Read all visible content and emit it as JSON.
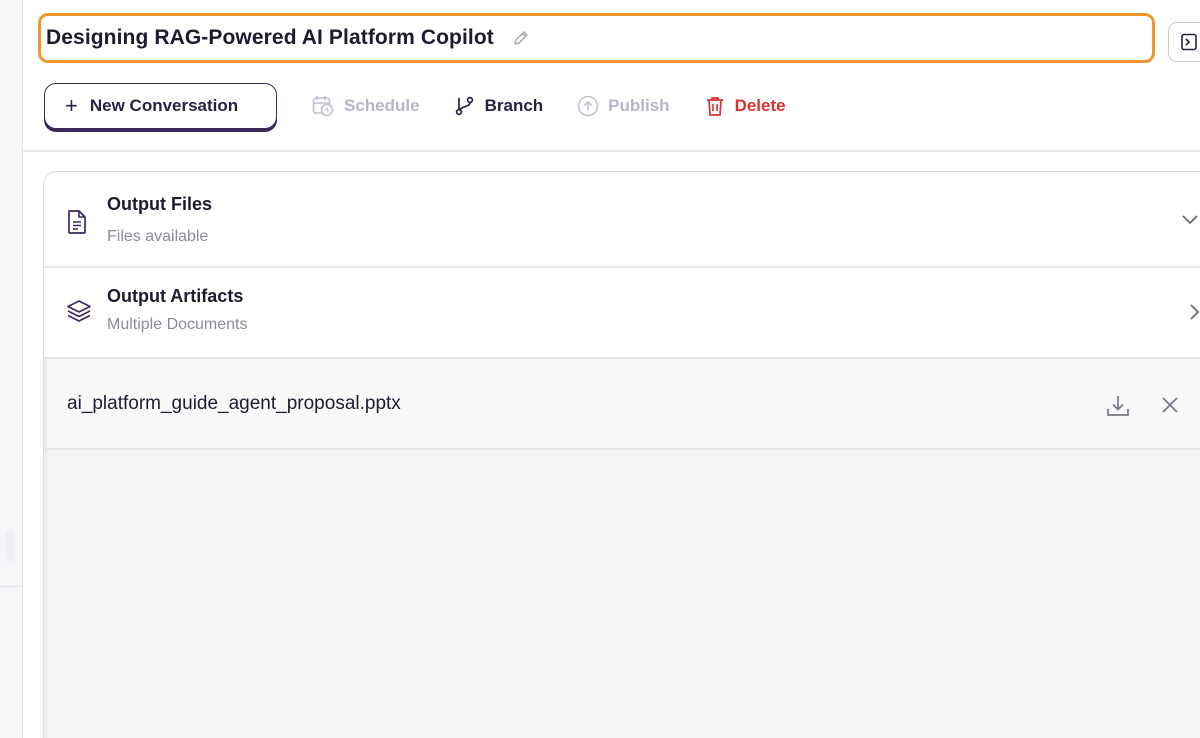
{
  "conversation": {
    "title": "Designing RAG-Powered AI Platform Copilot"
  },
  "toolbar": {
    "new_conversation": "New Conversation",
    "schedule": "Schedule",
    "branch": "Branch",
    "publish": "Publish",
    "delete": "Delete"
  },
  "outputs": {
    "files": {
      "title": "Output Files",
      "subtitle": "Files available"
    },
    "artifacts": {
      "title": "Output Artifacts",
      "subtitle": "Multiple Documents"
    },
    "open_file": {
      "name": "ai_platform_guide_agent_proposal.pptx"
    }
  },
  "colors": {
    "title_highlight": "#f0962e",
    "primary_text": "#1e1b2e",
    "disabled_text": "#b9b4c6",
    "danger": "#d8332f",
    "muted_text": "#8e8a99"
  },
  "icons": {
    "edit": "pencil-icon",
    "panel_toggle": "panel-toggle-icon",
    "new_conversation": "plus-icon",
    "schedule": "calendar-clock-icon",
    "branch": "git-branch-icon",
    "publish": "upload-circle-icon",
    "delete": "trash-icon",
    "files": "document-icon",
    "artifacts": "layers-icon",
    "files_expand": "chevron-down-icon",
    "artifacts_expand": "chevron-right-icon",
    "download": "download-icon",
    "close": "close-icon"
  }
}
